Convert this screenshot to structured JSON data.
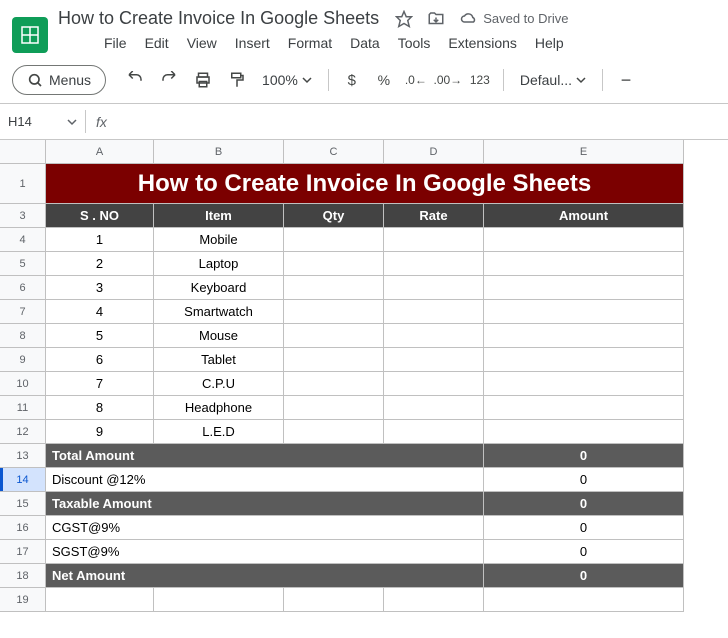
{
  "header": {
    "title": "How to Create Invoice In Google Sheets",
    "saved": "Saved to Drive"
  },
  "menubar": [
    "File",
    "Edit",
    "View",
    "Insert",
    "Format",
    "Data",
    "Tools",
    "Extensions",
    "Help"
  ],
  "toolbar": {
    "menus": "Menus",
    "zoom": "100%",
    "font": "Defaul...",
    "decimals": "123"
  },
  "namebox": "H14",
  "columns": [
    "A",
    "B",
    "C",
    "D",
    "E"
  ],
  "rows": [
    "1",
    "3",
    "4",
    "5",
    "6",
    "7",
    "8",
    "9",
    "10",
    "11",
    "12",
    "13",
    "14",
    "15",
    "16",
    "17",
    "18",
    "19"
  ],
  "banner": "How to Create Invoice In Google Sheets",
  "table_headers": {
    "sno": "S . NO",
    "item": "Item",
    "qty": "Qty",
    "rate": "Rate",
    "amount": "Amount"
  },
  "items": [
    {
      "sno": "1",
      "item": "Mobile"
    },
    {
      "sno": "2",
      "item": "Laptop"
    },
    {
      "sno": "3",
      "item": "Keyboard"
    },
    {
      "sno": "4",
      "item": "Smartwatch"
    },
    {
      "sno": "5",
      "item": "Mouse"
    },
    {
      "sno": "6",
      "item": "Tablet"
    },
    {
      "sno": "7",
      "item": "C.P.U"
    },
    {
      "sno": "8",
      "item": "Headphone"
    },
    {
      "sno": "9",
      "item": "L.E.D"
    }
  ],
  "summary": [
    {
      "label": "Total Amount",
      "value": "0",
      "dark": true
    },
    {
      "label": "Discount @12%",
      "value": "0",
      "dark": false
    },
    {
      "label": "Taxable Amount",
      "value": "0",
      "dark": true
    },
    {
      "label": "CGST@9%",
      "value": "0",
      "dark": false
    },
    {
      "label": "SGST@9%",
      "value": "0",
      "dark": false
    },
    {
      "label": "Net Amount",
      "value": "0",
      "dark": true
    }
  ]
}
